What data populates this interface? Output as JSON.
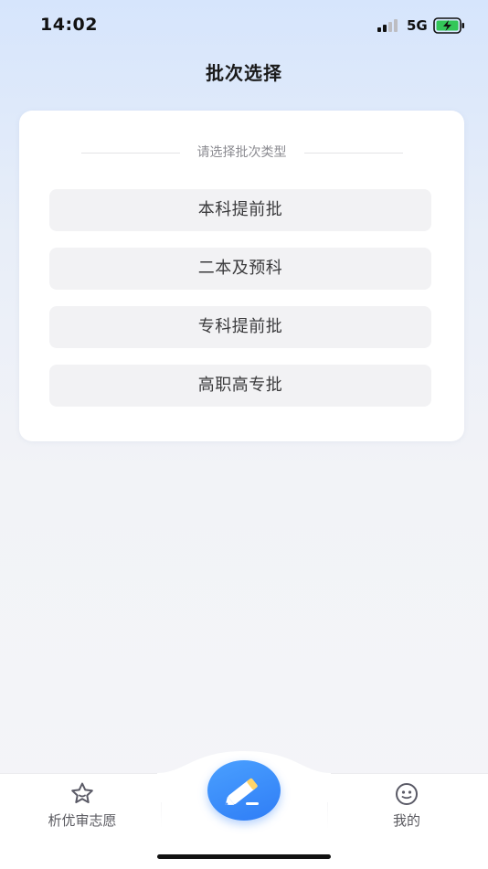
{
  "status_bar": {
    "time": "14:02",
    "network": "5G"
  },
  "header": {
    "title": "批次选择"
  },
  "card": {
    "section_label": "请选择批次类型",
    "options": [
      {
        "label": "本科提前批"
      },
      {
        "label": "二本及预科"
      },
      {
        "label": "专科提前批"
      },
      {
        "label": "高职高专批"
      }
    ]
  },
  "tab_bar": {
    "left_tab": {
      "label": "析优审志愿",
      "icon": "star-face-icon"
    },
    "center": {
      "icon": "pencil-icon"
    },
    "right_tab": {
      "label": "我的",
      "icon": "smiley-face-icon"
    }
  },
  "colors": {
    "accent": "#2f7df6",
    "battery": "#34c759",
    "option_bg": "#f2f2f4"
  }
}
